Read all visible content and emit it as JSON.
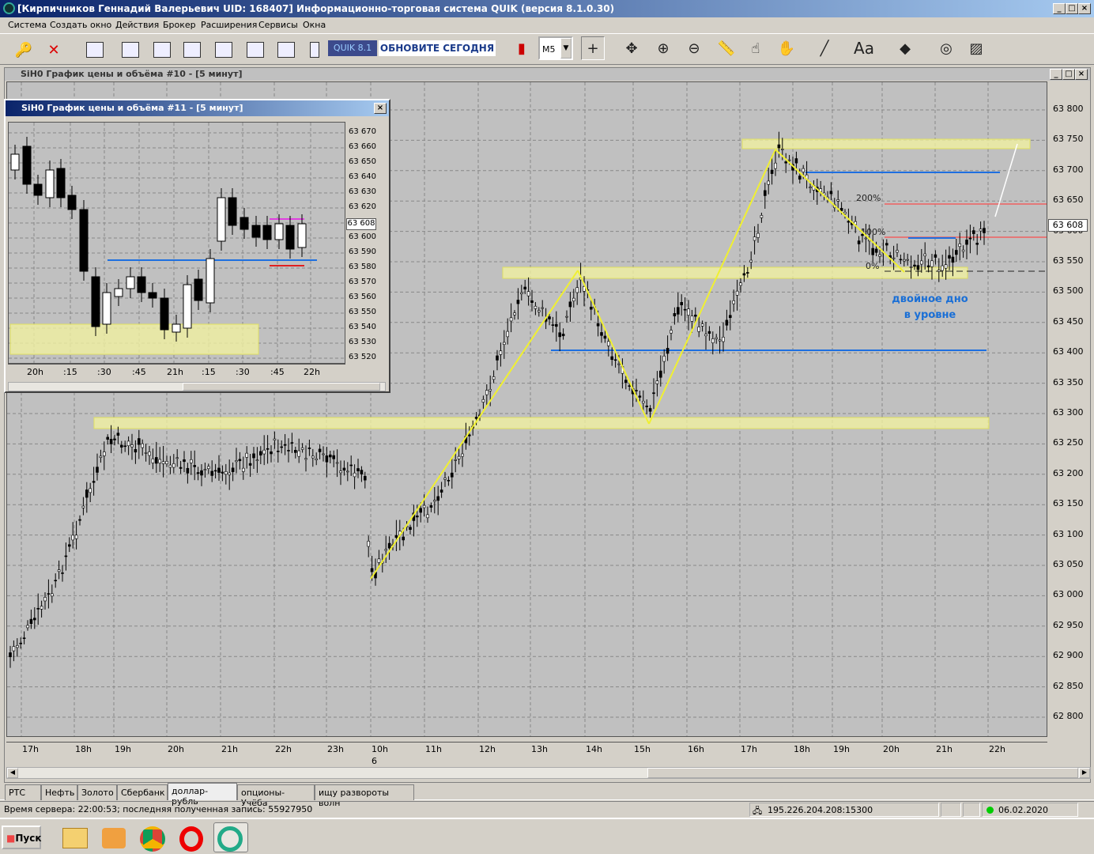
{
  "window": {
    "title": "[Кирпичников Геннадий Валерьевич UID: 168407] Информационно-торговая система QUIK (версия 8.1.0.30)",
    "min": "_",
    "max": "□",
    "close": "×"
  },
  "menu": [
    "Система",
    "Создать окно",
    "Действия",
    "Брокер",
    "Расширения",
    "Сервисы",
    "Окна"
  ],
  "toolbar": {
    "badge": "QUIK 8.1",
    "update": "ОБНОВИТЕ СЕГОДНЯ",
    "interval": "M5",
    "dropdown_arrow": "▼",
    "text_tool": "Aa"
  },
  "main_chart": {
    "title": "SiH0 График цены и объёма #10 - [5 минут]",
    "price_label": "63 608",
    "y_ticks": [
      "63 800",
      "63 750",
      "63 700",
      "63 650",
      "63 600",
      "63 550",
      "63 500",
      "63 450",
      "63 400",
      "63 350",
      "63 300",
      "63 250",
      "63 200",
      "63 150",
      "63 100",
      "63 050",
      "63 000",
      "62 950",
      "62 900",
      "62 850",
      "62 800"
    ],
    "x_ticks": [
      "17h",
      "18h",
      "19h",
      "20h",
      "21h",
      "22h",
      "23h",
      "10h",
      "11h",
      "12h",
      "13h",
      "14h",
      "15h",
      "16h",
      "17h",
      "18h",
      "19h",
      "20h",
      "21h",
      "22h"
    ],
    "day_marker": "6",
    "fib_labels": [
      "200%",
      "100%",
      "0%"
    ],
    "annotation_line1": "двойное дно",
    "annotation_line2": "в уровне"
  },
  "sub_chart": {
    "title": "SiH0 График цены и объёма #11 - [5 минут]",
    "close": "×",
    "price_label": "63 608",
    "y_ticks": [
      "63 670",
      "63 660",
      "63 650",
      "63 640",
      "63 630",
      "63 620",
      "63 610",
      "63 600",
      "63 590",
      "63 580",
      "63 570",
      "63 560",
      "63 550",
      "63 540",
      "63 530",
      "63 520"
    ],
    "x_ticks": [
      "20h",
      ":15",
      ":30",
      ":45",
      "21h",
      ":15",
      ":30",
      ":45",
      "22h"
    ]
  },
  "tabs": [
    "РТС",
    "Нефть",
    "Золото",
    "Сбербанк",
    "доллар-рубль",
    "опционы-Учёба",
    "ищу развороты волн"
  ],
  "active_tab": "доллар-рубль",
  "status": {
    "server": "Время сервера: 22:00:53; последняя полученная запись: 55927950",
    "connection": "195.226.204.208:15300",
    "date": "06.02.2020"
  },
  "taskbar": {
    "start": "Пуск"
  },
  "colors": {
    "yellow_line": "#f0f030",
    "blue_level": "#1e6fe0",
    "red_level": "#f06060",
    "zone_fill": "#f0f0a0"
  }
}
